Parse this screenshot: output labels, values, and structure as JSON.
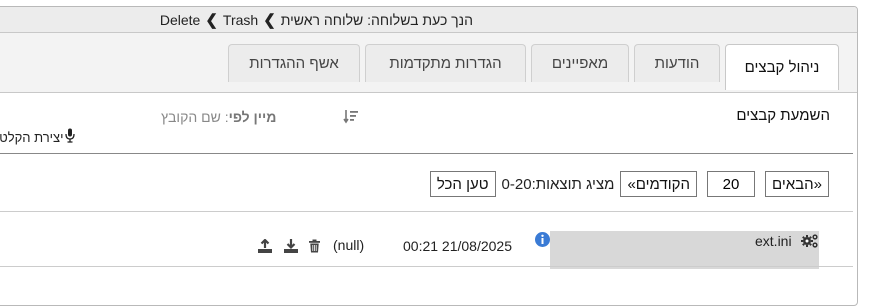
{
  "breadcrumb": {
    "current_prefix": "הנך כעת בשלוחה:",
    "current_name": "שלוחה ראשית",
    "item1": "Trash",
    "item2": "Delete"
  },
  "tabs": [
    {
      "label": "ניהול קבצים",
      "active": true
    },
    {
      "label": "הודעות"
    },
    {
      "label": "מאפיינים"
    },
    {
      "label": "הגדרות מתקדמות"
    },
    {
      "label": "אשף ההגדרות"
    }
  ],
  "files": {
    "title": "השמעת קבצים",
    "sort_label": "מיין לפי",
    "sort_value": ": שם הקובץ",
    "recording_label": "יצירת הקלטה"
  },
  "pager": {
    "next_label": "«הבאים",
    "page_size": "20",
    "prev_label": "הקודמים»",
    "showing_label": "מציג תוצאות:",
    "range": "0-20",
    "load_all_label": "טען הכל"
  },
  "file_rows": [
    {
      "name": "ext.ini",
      "datetime": "00:21 21/08/2025",
      "size": "(null)"
    }
  ],
  "colors": {
    "info": "#3a7bd5",
    "cell_bg": "#d8d8d8"
  }
}
